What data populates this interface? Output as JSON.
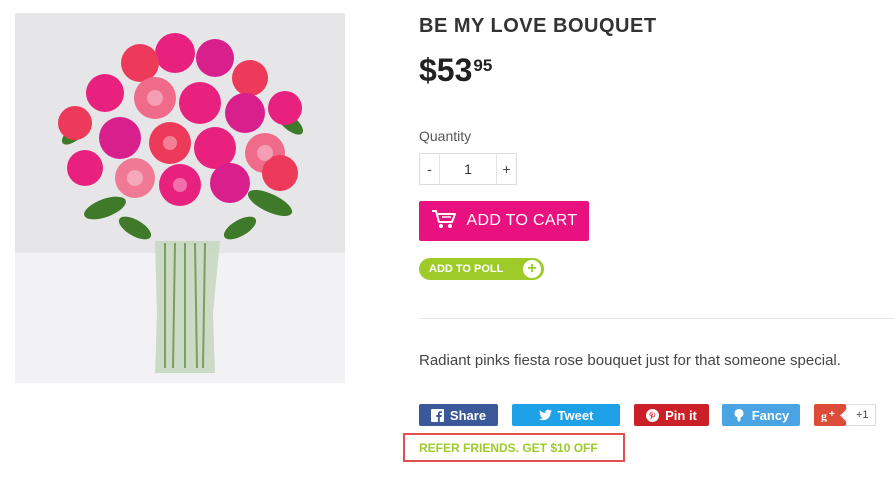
{
  "product": {
    "title": "BE MY LOVE BOUQUET",
    "price_main": "$53",
    "price_cents": "95",
    "description": "Radiant pinks fiesta rose bouquet just for that someone special."
  },
  "quantity": {
    "label": "Quantity",
    "minus": "-",
    "value": "1",
    "plus": "+"
  },
  "actions": {
    "add_to_cart": "ADD TO CART",
    "add_to_poll": "ADD TO POLL",
    "poll_plus": "+"
  },
  "share": {
    "facebook": "Share",
    "twitter": "Tweet",
    "pinterest": "Pin it",
    "fancy": "Fancy",
    "google_plus_count": "+1"
  },
  "refer": "REFER FRIENDS. GET $10 OFF",
  "colors": {
    "accent": "#e8117f",
    "poll": "#9ecb2a",
    "facebook": "#3b5998",
    "twitter": "#1ea1e6",
    "pinterest": "#cb2027",
    "fancy": "#4aa3e3",
    "google_plus": "#dd4b39"
  }
}
